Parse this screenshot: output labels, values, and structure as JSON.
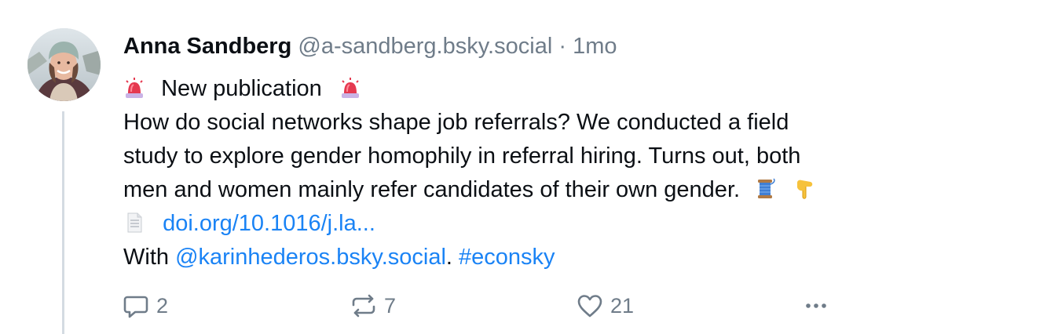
{
  "post": {
    "author_name": "Anna Sandberg",
    "author_handle": "@a-sandberg.bsky.social",
    "separator": "·",
    "time": "1mo",
    "heading": "New publication",
    "text_lines": [
      "How do social networks shape job referrals? We conducted a field",
      "study to explore gender homophily in referral hiring. Turns out, both",
      "men and women mainly refer candidates of their own gender."
    ],
    "link_text": "doi.org/10.1016/j.la...",
    "with_prefix": "With ",
    "mention": "@karinhederos.bsky.social",
    "mention_suffix": ". ",
    "hashtag": "#econsky",
    "emojis": [
      "rotating-light",
      "rotating-light",
      "thread-spool",
      "pointing-down",
      "page-facing-up"
    ]
  },
  "actions": {
    "reply_count": "2",
    "repost_count": "7",
    "like_count": "21"
  },
  "colors": {
    "link": "#1a83f5",
    "muted": "#6f7c89",
    "text": "#0b0f14",
    "thread_line": "#d4dbe2"
  }
}
